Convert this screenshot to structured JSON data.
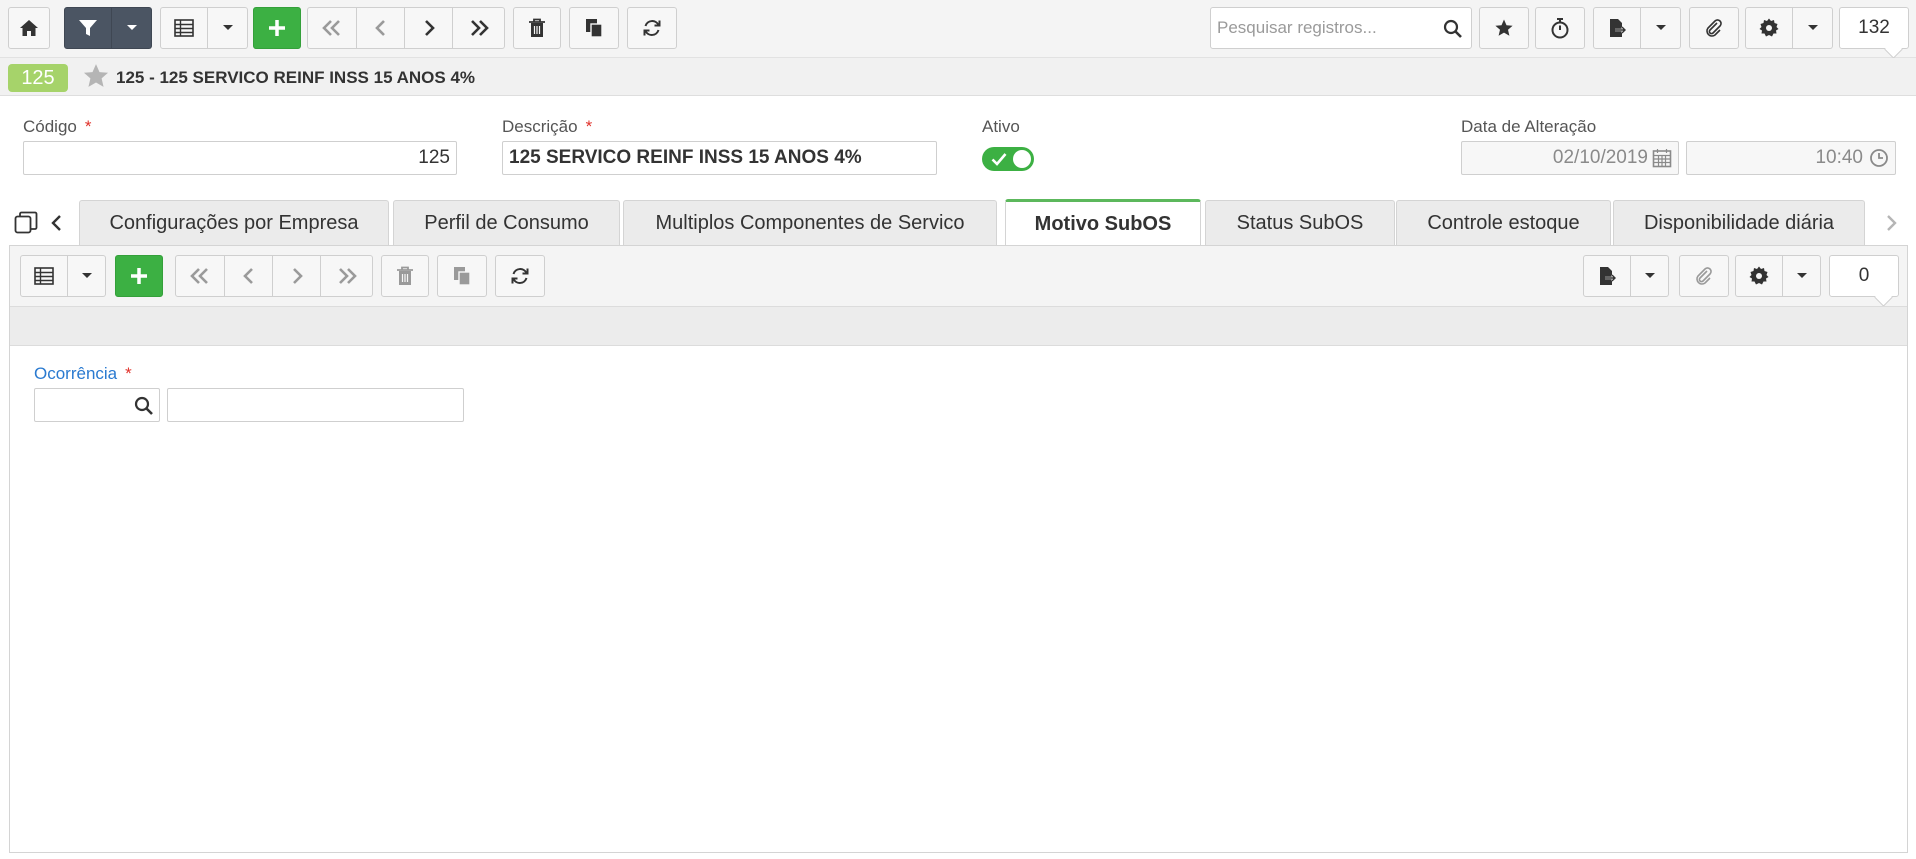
{
  "toolbar": {
    "search_placeholder": "Pesquisar registros...",
    "record_count": "132",
    "icons": [
      "home-icon",
      "filter-icon",
      "chevron-down-icon",
      "grid-icon",
      "plus-icon",
      "first-icon",
      "prev-icon",
      "next-icon",
      "last-icon",
      "trash-icon",
      "copy-icon",
      "refresh-icon",
      "search-icon",
      "star-icon",
      "timer-icon",
      "export-icon",
      "paperclip-icon",
      "gear-icon"
    ]
  },
  "record": {
    "badge": "125",
    "title": "125 - 125 SERVICO REINF INSS 15 ANOS 4%"
  },
  "form": {
    "codigo_label": "Código",
    "codigo_value": "125",
    "descricao_label": "Descrição",
    "descricao_value": "125 SERVICO REINF INSS 15 ANOS 4%",
    "ativo_label": "Ativo",
    "ativo_value": true,
    "data_label": "Data de Alteração",
    "data_value": "02/10/2019",
    "hora_value": "10:40",
    "required_mark": "*"
  },
  "tabs": [
    {
      "label": "Configurações por Empresa",
      "active": false
    },
    {
      "label": "Perfil de Consumo",
      "active": false
    },
    {
      "label": "Multiplos Componentes de Servico",
      "active": false
    },
    {
      "label": "Motivo SubOS",
      "active": true
    },
    {
      "label": "Status SubOS",
      "active": false
    },
    {
      "label": "Controle estoque",
      "active": false
    },
    {
      "label": "Disponibilidade diária",
      "active": false
    }
  ],
  "subpanel": {
    "record_count": "0",
    "ocorrencia_label": "Ocorrência",
    "ocorrencia_code": "",
    "ocorrencia_desc": ""
  },
  "colors": {
    "accent_green": "#3cb043",
    "badge_green": "#a6d36a",
    "tab_active_border": "#5cb85c",
    "link_blue": "#2a7ad0",
    "required_red": "#e0312a"
  }
}
